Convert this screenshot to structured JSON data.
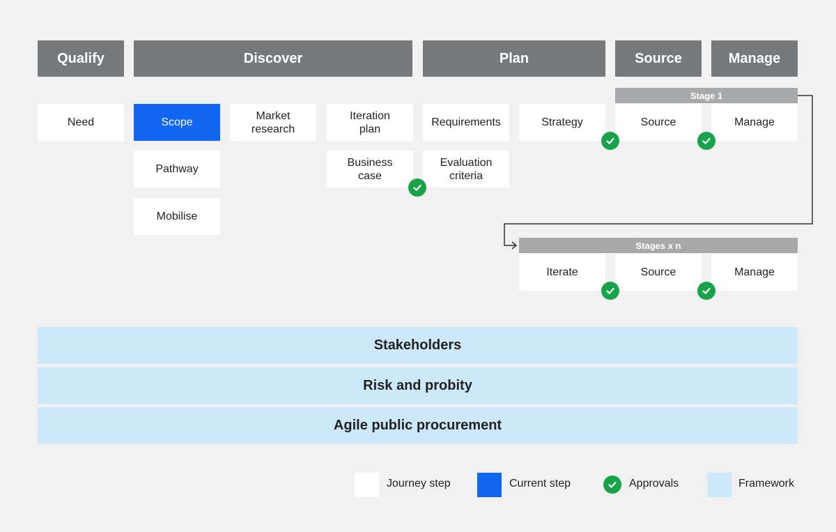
{
  "phases": {
    "qualify": "Qualify",
    "discover": "Discover",
    "plan": "Plan",
    "source": "Source",
    "manage": "Manage"
  },
  "steps": {
    "need": "Need",
    "scope": "Scope",
    "pathway": "Pathway",
    "mobilise": "Mobilise",
    "market_research": "Market\nresearch",
    "iteration_plan": "Iteration\nplan",
    "business_case": "Business\ncase",
    "requirements": "Requirements",
    "evaluation_criteria": "Evaluation\ncriteria",
    "strategy": "Strategy",
    "stage1_source": "Source",
    "stage1_manage": "Manage",
    "iterate": "Iterate",
    "stagesn_source": "Source",
    "stagesn_manage": "Manage"
  },
  "stages": {
    "stage1": "Stage 1",
    "stages_n": "Stages x n"
  },
  "frameworks": {
    "stakeholders": "Stakeholders",
    "risk": "Risk and probity",
    "agile": "Agile public procurement"
  },
  "legend": {
    "journey_step": "Journey step",
    "current_step": "Current step",
    "approvals": "Approvals",
    "framework": "Framework"
  },
  "colors": {
    "background": "#f1f1f1",
    "phase_header": "#75797b",
    "stage_bar": "#a7a9ab",
    "current_step": "#1266f1",
    "approval_check": "#18a34a",
    "framework": "#cde9f9"
  },
  "icons": {
    "approval": "check-circle-icon",
    "connector": "arrow-right-icon"
  }
}
